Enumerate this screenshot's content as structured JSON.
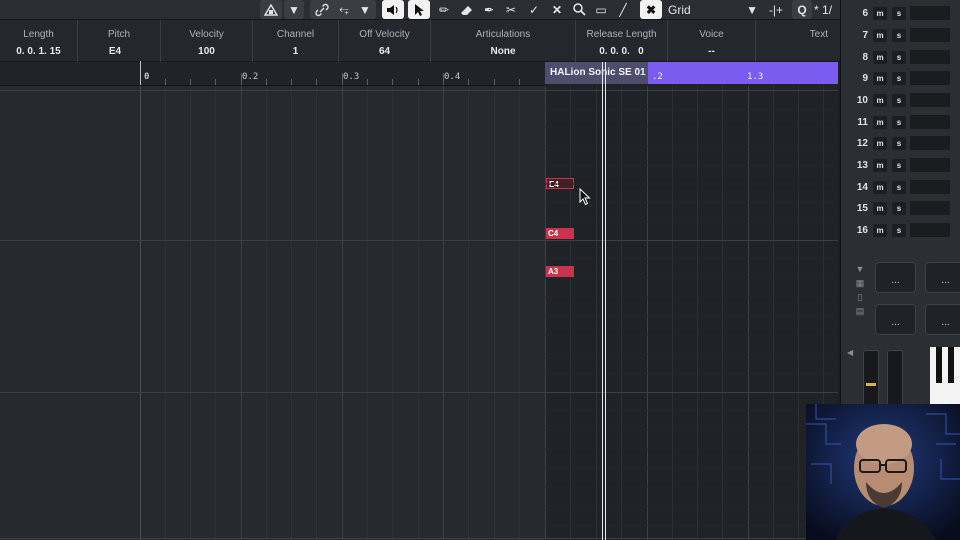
{
  "toolbar": {
    "grid_label": "Grid",
    "quantize_value": "1/",
    "quantize_prefix": "*"
  },
  "infoline": {
    "columns": [
      {
        "header": "Length",
        "value": "0. 0. 1. 15"
      },
      {
        "header": "Pitch",
        "value": "E4"
      },
      {
        "header": "Velocity",
        "value": "100"
      },
      {
        "header": "Channel",
        "value": "1"
      },
      {
        "header": "Off Velocity",
        "value": "64"
      },
      {
        "header": "Articulations",
        "value": "None"
      },
      {
        "header": "Release Length",
        "value": "0. 0. 0.   0"
      },
      {
        "header": "Voice",
        "value": "--"
      },
      {
        "header": "Text",
        "value": ""
      }
    ]
  },
  "ruler": {
    "labels": [
      "0",
      "0.2",
      "0.3",
      "0.4"
    ]
  },
  "part": {
    "name": "HALion Sonic SE 01",
    "bar_labels": [
      ".2",
      "1.3"
    ]
  },
  "notes": [
    {
      "pitch": "E4",
      "state": "selected"
    },
    {
      "pitch": "C4",
      "state": "normal"
    },
    {
      "pitch": "A3",
      "state": "normal"
    }
  ],
  "rack": {
    "channels": [
      {
        "number": "6",
        "mute": "m",
        "solo": "s"
      },
      {
        "number": "7",
        "mute": "m",
        "solo": "s"
      },
      {
        "number": "8",
        "mute": "m",
        "solo": "s"
      },
      {
        "number": "9",
        "mute": "m",
        "solo": "s"
      },
      {
        "number": "10",
        "mute": "m",
        "solo": "s"
      },
      {
        "number": "11",
        "mute": "m",
        "solo": "s"
      },
      {
        "number": "12",
        "mute": "m",
        "solo": "s"
      },
      {
        "number": "13",
        "mute": "m",
        "solo": "s"
      },
      {
        "number": "14",
        "mute": "m",
        "solo": "s"
      },
      {
        "number": "15",
        "mute": "m",
        "solo": "s"
      },
      {
        "number": "16",
        "mute": "m",
        "solo": "s"
      }
    ],
    "pads": [
      "...",
      "...",
      "...",
      "..."
    ]
  },
  "colors": {
    "note_normal": "#c9344c",
    "note_selected": "#4a1c24",
    "part_bar": "#7b5cf0",
    "part_label_bg": "#4f4d6c"
  }
}
